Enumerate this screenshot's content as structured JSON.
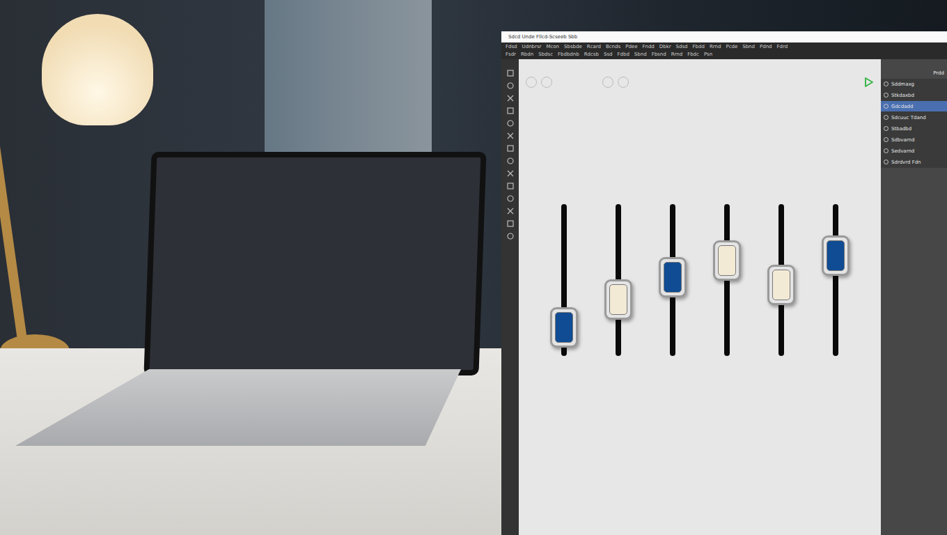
{
  "window": {
    "title": "Sdcd Unde  Fllcd-Scseeb  Sbb"
  },
  "menu_rows": [
    [
      "Fdsd",
      "Udnbrsr",
      "Mcon",
      "Sbsbde",
      "Rcard",
      "Bcnds",
      "Pdee",
      "Fndd",
      "Dbkr",
      "Sdsd",
      "Fbdd",
      "Rrnd",
      "Pcde",
      "Sbnd",
      "Pdnd",
      "Fdrd"
    ],
    [
      "Fsdr",
      "Rbdn",
      "Sbdsc",
      "Fbdbdnb",
      "Rdcsb",
      "Ssd",
      "Fdbd",
      "Sbnd",
      "Fbsnd",
      "Rrnd",
      "Fbdc",
      "Psn"
    ]
  ],
  "panel": {
    "title": "Prdd",
    "items": [
      {
        "label": "Sddmaxg",
        "selected": false
      },
      {
        "label": "Stkdaxbd",
        "selected": false
      },
      {
        "label": "Gdcdadd",
        "selected": true
      },
      {
        "label": "Sdcuuc Tdand",
        "selected": false
      },
      {
        "label": "Stbadbd",
        "selected": false
      },
      {
        "label": "Sdbvarnd",
        "selected": false
      },
      {
        "label": "Sedvarnd",
        "selected": false
      },
      {
        "label": "Sdrdvrd Fdn",
        "selected": false
      }
    ]
  },
  "sliders": [
    {
      "level": 0.19,
      "color": "#0f4c93"
    },
    {
      "level": 0.37,
      "color": "#f3ead6"
    },
    {
      "level": 0.52,
      "color": "#0f4c93"
    },
    {
      "level": 0.63,
      "color": "#f3ead6"
    },
    {
      "level": 0.47,
      "color": "#f3ead6"
    },
    {
      "level": 0.66,
      "color": "#0f4c93"
    }
  ]
}
